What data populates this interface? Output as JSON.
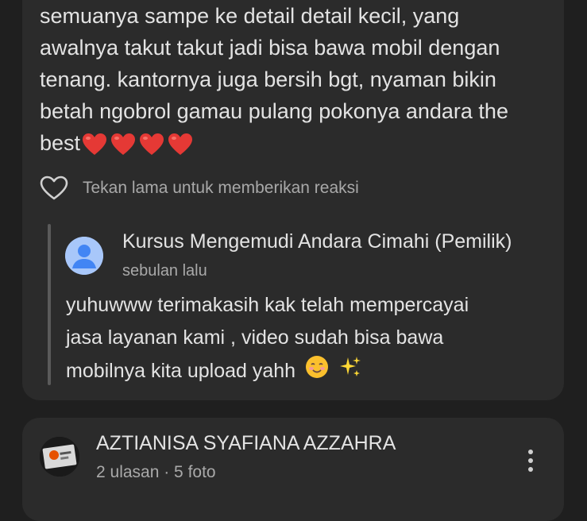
{
  "review": {
    "lines": [
      "semuanya sampe ke detail detail kecil, yang",
      "awalnya takut takut jadi bisa bawa mobil dengan",
      "tenang. kantornya juga bersih bgt, nyaman bikin",
      "betah ngobrol gamau pulang pokonya andara the",
      "best"
    ],
    "trailing_emoji": "❤️❤️❤️❤️",
    "reaction_hint": "Tekan lama untuk memberikan reaksi",
    "reaction_icon": "heart-outline-icon"
  },
  "owner_reply": {
    "name": "Kursus Mengemudi Andara Cimahi (Pemilik)",
    "time": "sebulan lalu",
    "lines": [
      "yuhuwww terimakasih kak telah mempercayai",
      "jasa layanan kami , video sudah bisa bawa",
      "mobilnya kita upload yahh"
    ],
    "trailing_emoji": "☺️✨",
    "avatar_icon": "default-person-avatar"
  },
  "next_review": {
    "reviewer_name": "AZTIANISA SYAFIANA AZZAHRA",
    "meta": "2 ulasan · 5 foto",
    "more_icon": "more-vert-icon"
  },
  "colors": {
    "background": "#1f1f1f",
    "card": "#2b2b2b",
    "heart": "#e53935",
    "avatar_blue": "#a8c7fa"
  }
}
